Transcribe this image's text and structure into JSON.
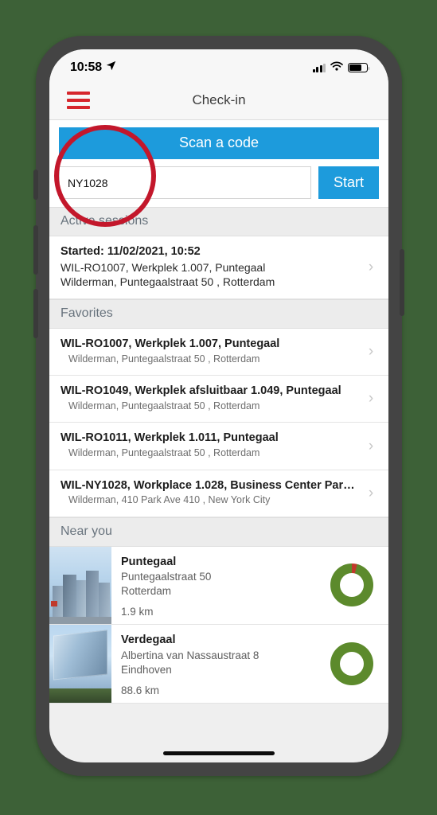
{
  "device": {
    "status_bar": {
      "time": "10:58",
      "location_icon": "location-arrow-icon",
      "signal_icon": "cellular-signal-icon",
      "wifi_icon": "wifi-icon",
      "battery_icon": "battery-icon"
    },
    "home_indicator": "home-indicator"
  },
  "nav": {
    "menu_icon": "hamburger-menu-icon",
    "title": "Check-in"
  },
  "scan": {
    "scan_button_label": "Scan a code",
    "code_value": "NY1028",
    "code_placeholder": "",
    "start_button_label": "Start"
  },
  "sections": {
    "active_sessions": {
      "header": "Active sessions",
      "items": [
        {
          "started": "Started: 11/02/2021, 10:52",
          "workplace": "WIL-RO1007, Werkplek 1.007, Puntegaal",
          "address": "Wilderman, Puntegaalstraat 50 , Rotterdam",
          "chevron": "chevron-right-icon"
        }
      ]
    },
    "favorites": {
      "header": "Favorites",
      "items": [
        {
          "title": "WIL-RO1007, Werkplek 1.007, Puntegaal",
          "sub": "Wilderman, Puntegaalstraat 50 , Rotterdam"
        },
        {
          "title": "WIL-RO1049, Werkplek afsluitbaar 1.049, Puntegaal",
          "sub": "Wilderman, Puntegaalstraat 50 , Rotterdam"
        },
        {
          "title": "WIL-RO1011, Werkplek 1.011, Puntegaal",
          "sub": "Wilderman, Puntegaalstraat 50 , Rotterdam"
        },
        {
          "title": "WIL-NY1028, Workplace 1.028, Business Center Par…",
          "sub": "Wilderman, 410 Park Ave 410 , New York City"
        }
      ]
    },
    "near_you": {
      "header": "Near you",
      "items": [
        {
          "name": "Puntegaal",
          "street": "Puntegaalstraat 50",
          "city": "Rotterdam",
          "distance": "1.9 km",
          "thumb": "building-photo-rotterdam",
          "occupancy_icon": "occupancy-donut-chart",
          "occupancy_free_pct": 96,
          "occupancy_used_pct": 4
        },
        {
          "name": "Verdegaal",
          "street": "Albertina van Nassaustraat 8",
          "city": "Eindhoven",
          "distance": "88.6 km",
          "thumb": "building-photo-eindhoven",
          "occupancy_icon": "occupancy-donut-chart",
          "occupancy_free_pct": 100,
          "occupancy_used_pct": 0
        }
      ]
    }
  },
  "annotation": {
    "shape": "circle-highlight",
    "color": "#c3172b",
    "target": "code-input"
  },
  "colors": {
    "accent_blue": "#1d9bdc",
    "menu_red": "#d6262c",
    "annotation_red": "#c3172b",
    "donut_green": "#5c8a2c",
    "donut_red": "#c0392b",
    "page_background": "#3d6137"
  }
}
